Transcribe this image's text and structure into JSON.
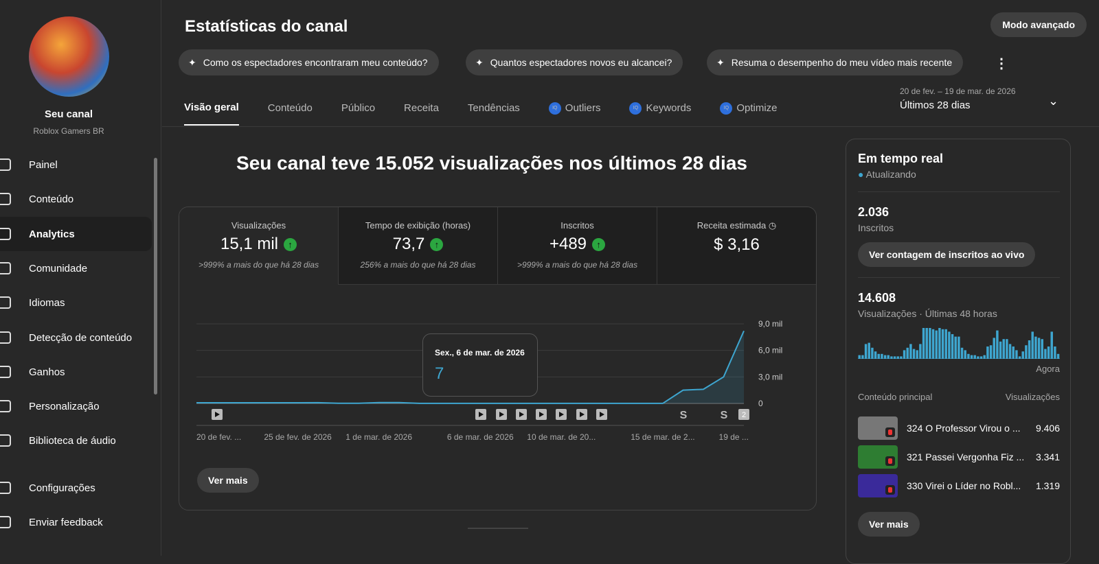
{
  "sidebar": {
    "channel_title": "Seu canal",
    "channel_name": "Roblox Gamers BR",
    "items": [
      {
        "label": "Painel",
        "icon": "dashboard-icon"
      },
      {
        "label": "Conteúdo",
        "icon": "content-icon"
      },
      {
        "label": "Analytics",
        "icon": "analytics-icon"
      },
      {
        "label": "Comunidade",
        "icon": "community-icon"
      },
      {
        "label": "Idiomas",
        "icon": "subtitles-icon"
      },
      {
        "label": "Detecção de conteúdo",
        "icon": "copyright-icon"
      },
      {
        "label": "Ganhos",
        "icon": "dollar-icon"
      },
      {
        "label": "Personalização",
        "icon": "magic-wand-icon"
      },
      {
        "label": "Biblioteca de áudio",
        "icon": "audio-library-icon"
      }
    ],
    "bottom": [
      {
        "label": "Configurações",
        "icon": "gear-icon"
      },
      {
        "label": "Enviar feedback",
        "icon": "feedback-icon"
      }
    ]
  },
  "header": {
    "title": "Estatísticas do canal",
    "advanced": "Modo avançado",
    "chips": [
      "Como os espectadores encontraram meu conteúdo?",
      "Quantos espectadores novos eu alcancei?",
      "Resuma o desempenho do meu vídeo mais recente"
    ],
    "tabs": [
      "Visão geral",
      "Conteúdo",
      "Público",
      "Receita",
      "Tendências",
      "Outliers",
      "Keywords",
      "Optimize"
    ],
    "range_dates": "20 de fev. – 19 de mar. de 2026",
    "range_label": "Últimos 28 dias"
  },
  "overview": {
    "headline": "Seu canal teve 15.052 visualizações nos últimos 28 dias",
    "metrics": [
      {
        "title": "Visualizações",
        "value": "15,1 mil",
        "change": ">999% a mais do que há 28 dias"
      },
      {
        "title": "Tempo de exibição (horas)",
        "value": "73,7",
        "change": "256% a mais do que há 28 dias"
      },
      {
        "title": "Inscritos",
        "value": "+489",
        "change": ">999% a mais do que há 28 dias"
      },
      {
        "title": "Receita estimada",
        "value": "$ 3,16",
        "change": ""
      }
    ],
    "see_more": "Ver mais",
    "tooltip_date": "Sex., 6 de mar. de 2026",
    "tooltip_value": "7",
    "marker_badge": "2"
  },
  "chart_data": {
    "type": "line",
    "title": "Visualizações",
    "ylim": [
      0,
      9000
    ],
    "yticks": [
      "0",
      "3,0 mil",
      "6,0 mil",
      "9,0 mil"
    ],
    "xticks": [
      "20 de fev. ...",
      "25 de fev. de 2026",
      "1 de mar. de 2026",
      "6 de mar. de 2026",
      "10 de mar. de 20...",
      "15 de mar. de 2...",
      "19 de ..."
    ],
    "values": [
      80,
      80,
      80,
      80,
      80,
      80,
      90,
      20,
      20,
      100,
      100,
      10,
      5,
      5,
      7,
      5,
      5,
      5,
      5,
      5,
      5,
      5,
      5,
      5,
      1500,
      1600,
      3000,
      8200
    ]
  },
  "realtime": {
    "title": "Em tempo real",
    "status": "Atualizando",
    "subs_value": "2.036",
    "subs_label": "Inscritos",
    "live_button": "Ver contagem de inscritos ao vivo",
    "views_value": "14.608",
    "views_label": "Visualizações · Últimas 48 horas",
    "now_label": "Agora",
    "bars": [
      3,
      3,
      12,
      13,
      9,
      6,
      4,
      4,
      3,
      3,
      2,
      2,
      2,
      2,
      7,
      9,
      12,
      8,
      7,
      12,
      25,
      25,
      25,
      24,
      23,
      25,
      24,
      24,
      22,
      20,
      18,
      18,
      9,
      7,
      4,
      3,
      3,
      2,
      2,
      3,
      10,
      11,
      17,
      23,
      14,
      16,
      16,
      12,
      10,
      7,
      2,
      6,
      11,
      15,
      22,
      18,
      17,
      16,
      8,
      10,
      22,
      10,
      4
    ],
    "top_header": "Conteúdo principal",
    "top_views": "Visualizações",
    "top": [
      {
        "title": "324 O Professor Virou o ...",
        "views": "9.406",
        "color": "#777"
      },
      {
        "title": "321 Passei Vergonha Fiz ...",
        "views": "3.341",
        "color": "#2e7d32"
      },
      {
        "title": "330 Virei o Líder no Robl...",
        "views": "1.319",
        "color": "#3a2a9a"
      }
    ],
    "see_more": "Ver mais"
  }
}
